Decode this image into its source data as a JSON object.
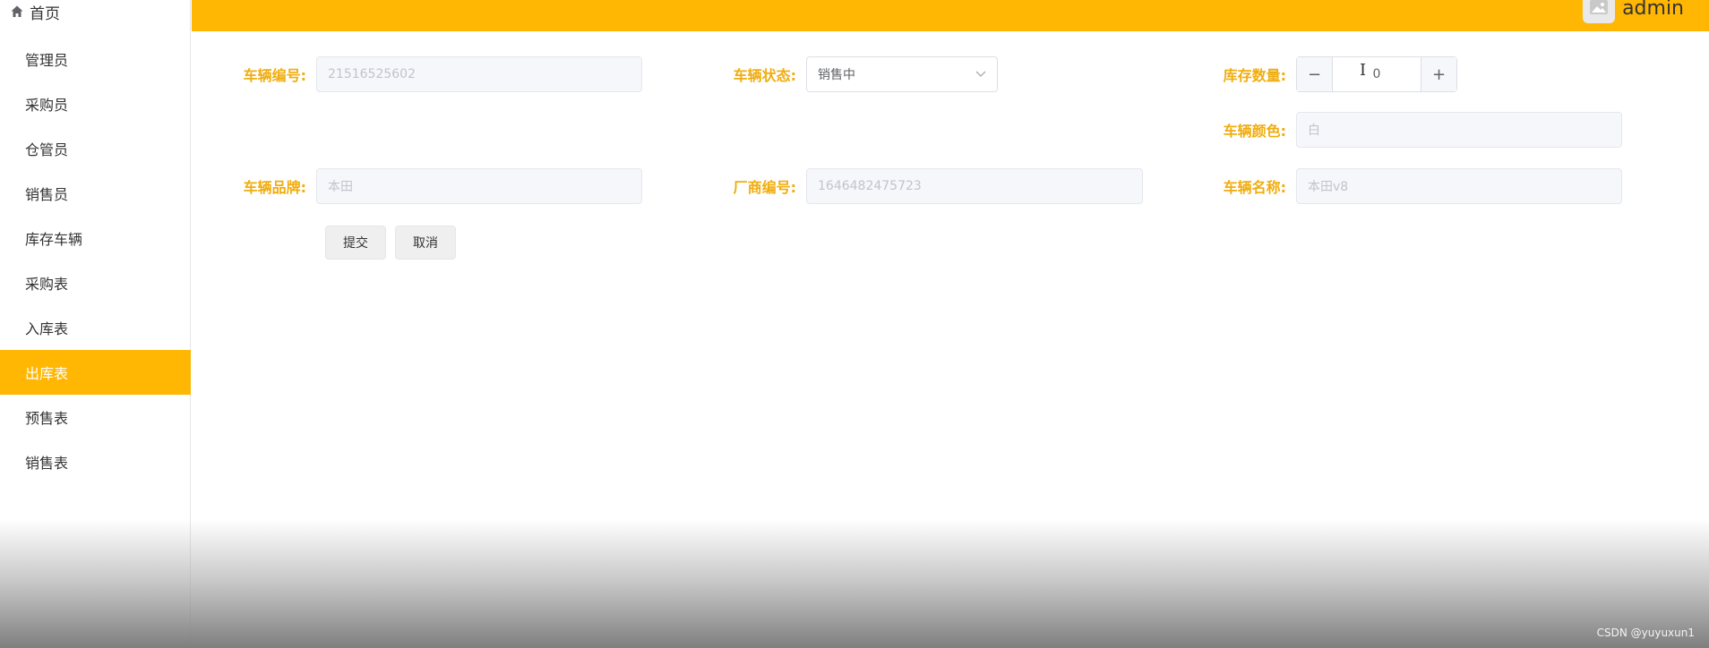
{
  "sidebar": {
    "home_label": "首页",
    "items": [
      {
        "label": "管理员"
      },
      {
        "label": "采购员"
      },
      {
        "label": "仓管员"
      },
      {
        "label": "销售员"
      },
      {
        "label": "库存车辆"
      },
      {
        "label": "采购表"
      },
      {
        "label": "入库表"
      },
      {
        "label": "出库表",
        "active": true
      },
      {
        "label": "预售表"
      },
      {
        "label": "销售表"
      }
    ]
  },
  "header": {
    "username": "admin",
    "avatar_icon": "image-icon"
  },
  "form": {
    "vehicle_no": {
      "label": "车辆编号:",
      "placeholder": "21516525602"
    },
    "vehicle_status": {
      "label": "车辆状态:",
      "value": "销售中"
    },
    "stock_qty": {
      "label": "库存数量:",
      "value": "0",
      "minus": "−",
      "plus": "+"
    },
    "vehicle_color": {
      "label": "车辆颜色:",
      "placeholder": "白"
    },
    "vehicle_brand": {
      "label": "车辆品牌:",
      "placeholder": "本田"
    },
    "maker_no": {
      "label": "厂商编号:",
      "placeholder": "1646482475723"
    },
    "vehicle_name": {
      "label": "车辆名称:",
      "placeholder": "本田v8"
    },
    "submit_label": "提交",
    "cancel_label": "取消"
  },
  "watermark": "CSDN @yuyuxun1",
  "colors": {
    "accent": "#ffb703",
    "label": "#f0ad0f"
  }
}
